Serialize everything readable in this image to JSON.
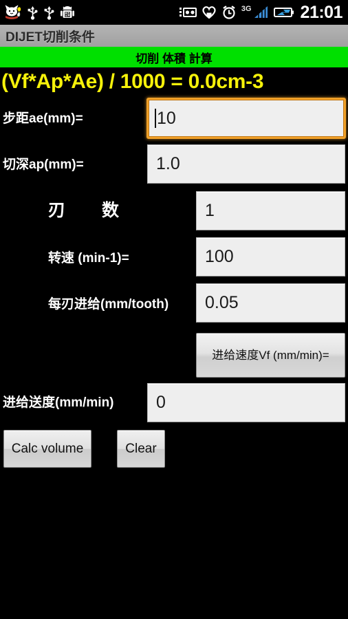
{
  "statusbar": {
    "icons": [
      "cat-icon",
      "usb-icon",
      "usb-icon",
      "android-robot-icon",
      "sync-device-icon",
      "heart-icon",
      "alarm-clock-icon",
      "signal-bars-icon",
      "battery-charging-icon"
    ],
    "network_label": "3G",
    "time": "21:01"
  },
  "titlebar": {
    "title": "DIJET切削条件"
  },
  "subheader": {
    "title": "切削 体積 計算"
  },
  "formula": {
    "text": "(Vf*Ap*Ae) / 1000 = 0.0cm-3",
    "color": "#f5f10a"
  },
  "fields": [
    {
      "label": "步距ae(mm)=",
      "value": "10",
      "focused": true
    },
    {
      "label": "切深ap(mm)=",
      "value": "1.0",
      "focused": false
    },
    {
      "label": "刃　数",
      "value": "1",
      "focused": false
    },
    {
      "label": "转速 (min-1)=",
      "value": "100",
      "focused": false
    },
    {
      "label": "每刃进给(mm/tooth)",
      "value": "0.05",
      "focused": false
    },
    {
      "label": "进给送度(mm/min)",
      "value": "0",
      "focused": false
    }
  ],
  "vf_button": {
    "label": "进给速度Vf (mm/min)="
  },
  "actions": {
    "calc_label": "Calc volume",
    "clear_label": "Clear"
  },
  "colors": {
    "background": "#000000",
    "accent_green": "#00e000",
    "formula_yellow": "#f5f10a",
    "focus_orange": "#f0a028",
    "field_bg": "#eeeeee"
  }
}
